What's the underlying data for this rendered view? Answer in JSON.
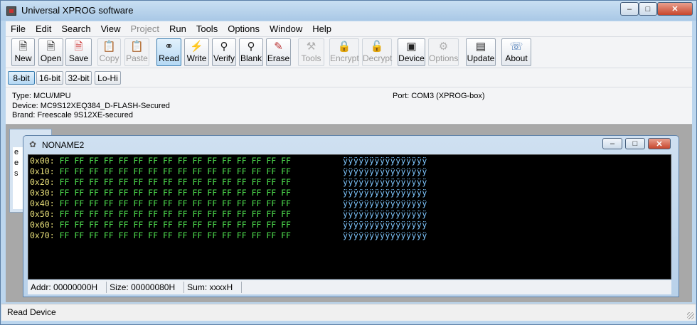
{
  "window": {
    "title": "Universal XPROG software"
  },
  "menu": [
    "File",
    "Edit",
    "Search",
    "View",
    "Project",
    "Run",
    "Tools",
    "Options",
    "Window",
    "Help"
  ],
  "menu_disabled": [
    "Project"
  ],
  "toolbar": {
    "new": "New",
    "open": "Open",
    "save": "Save",
    "copy": "Copy",
    "paste": "Paste",
    "read": "Read",
    "write": "Write",
    "verify": "Verify",
    "blank": "Blank",
    "erase": "Erase",
    "tools": "Tools",
    "encrypt": "Encrypt",
    "decrypt": "Decrypt",
    "device": "Device",
    "options": "Options",
    "update": "Update",
    "about": "About"
  },
  "size_modes": [
    "8-bit",
    "16-bit",
    "32-bit",
    "Lo-Hi"
  ],
  "selected_size_mode": "8-bit",
  "info": {
    "type": "Type: MCU/MPU",
    "device": "Device: MC9S12XEQ384_D-FLASH-Secured",
    "brand": "Brand: Freescale 9S12XE-secured",
    "port": "Port: COM3 (XPROG-box)"
  },
  "background_child": {
    "lines": [
      "e",
      "e",
      "s"
    ]
  },
  "child": {
    "title": "NONAME2",
    "rows": [
      {
        "addr": "0x00:",
        "bytes": "FF FF FF FF FF FF FF FF FF FF FF FF FF FF FF FF",
        "ascii": "ÿÿÿÿÿÿÿÿÿÿÿÿÿÿÿÿ"
      },
      {
        "addr": "0x10:",
        "bytes": "FF FF FF FF FF FF FF FF FF FF FF FF FF FF FF FF",
        "ascii": "ÿÿÿÿÿÿÿÿÿÿÿÿÿÿÿÿ"
      },
      {
        "addr": "0x20:",
        "bytes": "FF FF FF FF FF FF FF FF FF FF FF FF FF FF FF FF",
        "ascii": "ÿÿÿÿÿÿÿÿÿÿÿÿÿÿÿÿ"
      },
      {
        "addr": "0x30:",
        "bytes": "FF FF FF FF FF FF FF FF FF FF FF FF FF FF FF FF",
        "ascii": "ÿÿÿÿÿÿÿÿÿÿÿÿÿÿÿÿ"
      },
      {
        "addr": "0x40:",
        "bytes": "FF FF FF FF FF FF FF FF FF FF FF FF FF FF FF FF",
        "ascii": "ÿÿÿÿÿÿÿÿÿÿÿÿÿÿÿÿ"
      },
      {
        "addr": "0x50:",
        "bytes": "FF FF FF FF FF FF FF FF FF FF FF FF FF FF FF FF",
        "ascii": "ÿÿÿÿÿÿÿÿÿÿÿÿÿÿÿÿ"
      },
      {
        "addr": "0x60:",
        "bytes": "FF FF FF FF FF FF FF FF FF FF FF FF FF FF FF FF",
        "ascii": "ÿÿÿÿÿÿÿÿÿÿÿÿÿÿÿÿ"
      },
      {
        "addr": "0x70:",
        "bytes": "FF FF FF FF FF FF FF FF FF FF FF FF FF FF FF FF",
        "ascii": "ÿÿÿÿÿÿÿÿÿÿÿÿÿÿÿÿ"
      }
    ],
    "status": {
      "addr": "Addr: 00000000H",
      "size": "Size: 00000080H",
      "sum": "Sum: xxxxH"
    }
  },
  "status_bar": "Read Device",
  "colors": {
    "hex_bg": "#000000",
    "addr": "#e8e07a",
    "bytes": "#4fe04f",
    "ascii": "#7fc7ff"
  }
}
